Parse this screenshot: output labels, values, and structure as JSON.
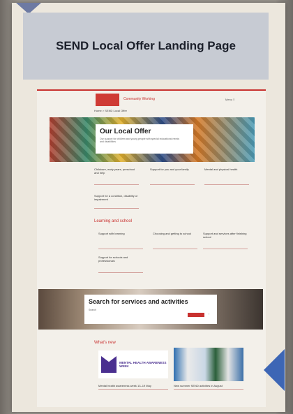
{
  "poster": {
    "title": "SEND Local Offer Landing Page"
  },
  "site": {
    "brand": "Community Working",
    "menu": "Menu ≡",
    "breadcrumb": "Home > SEND Local Offer"
  },
  "hero": {
    "heading": "Our Local Offer",
    "text": "Our support for children and young people with special educational needs and disabilities"
  },
  "links": [
    "Childcare, early years, preschool and help",
    "Support for you and your family",
    "Mental and physical health",
    "Support for a condition, disability or impairment"
  ],
  "learning": {
    "title": "Learning and school",
    "links": [
      "Support with learning",
      "Choosing and getting to school",
      "Support and services after finishing school",
      "Support for schools and professionals"
    ]
  },
  "search": {
    "heading": "Search for services and activities",
    "label": "Search"
  },
  "news": {
    "title": "What's new",
    "items": [
      {
        "logo_text": "MENTAL HEALTH AWARENESS WEEK",
        "caption": "Mental health awareness week 13–19 May"
      },
      {
        "caption": "New summer SEND activities in August"
      }
    ]
  }
}
